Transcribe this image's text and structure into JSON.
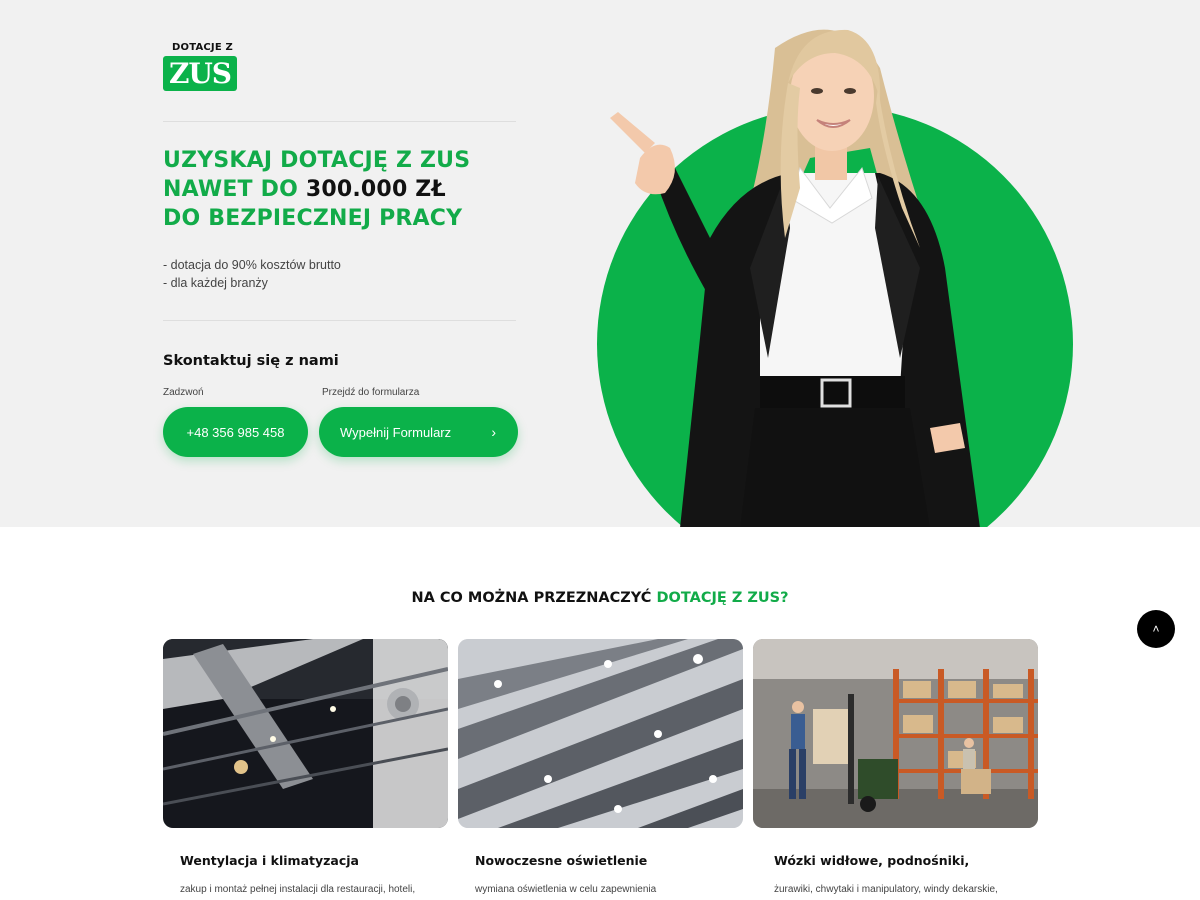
{
  "logo": {
    "top_text": "DOTACJE Z",
    "mark": "ZUS"
  },
  "hero": {
    "headline_line1": "UZYSKAJ DOTACJĘ Z ZUS",
    "headline_line2_prefix": "NAWET DO ",
    "headline_line2_amount": "300.000 ZŁ",
    "headline_line3": "DO BEZPIECZNEJ PRACY",
    "bullets": [
      "- dotacja do 90% kosztów brutto",
      "- dla każdej branży"
    ]
  },
  "contact": {
    "title": "Skontaktuj się z nami",
    "call_label": "Zadzwoń",
    "form_label": "Przejdź do formularza",
    "phone_button": "+48 356 985 458",
    "form_button": "Wypełnij Formularz",
    "form_button_icon": "chevron-right-icon"
  },
  "section": {
    "title_prefix": "NA CO MOŻNA PRZEZNACZYĆ ",
    "title_highlight": "DOTACJĘ Z ZUS?"
  },
  "cards": [
    {
      "title": "Wentylacja i klimatyzacja",
      "desc": "zakup i montaż pełnej instalacji dla restauracji, hoteli,"
    },
    {
      "title": "Nowoczesne oświetlenie",
      "desc": "wymiana oświetlenia w celu zapewnienia"
    },
    {
      "title": "Wózki widłowe, podnośniki,",
      "desc": "żurawiki, chwytaki i manipulatory, windy dekarskie,"
    }
  ],
  "scroll_top_icon": "chevron-up-icon",
  "colors": {
    "brand_green": "#0bb24a",
    "hero_bg": "#f1f1f1"
  }
}
